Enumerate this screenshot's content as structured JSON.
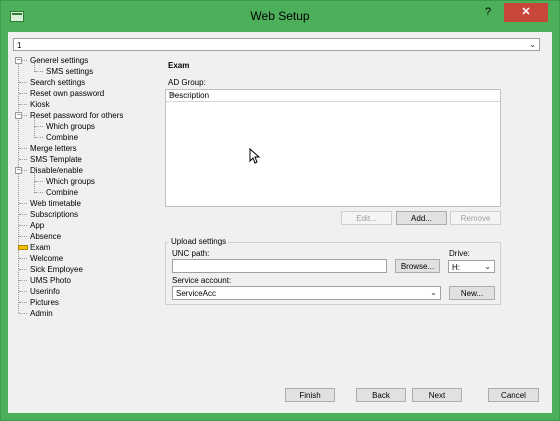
{
  "window": {
    "title": "Web Setup",
    "help_label": "?",
    "close_label": "✕",
    "accent": "#4cb05a",
    "close_color": "#c7483a"
  },
  "top_combo": {
    "value": "1"
  },
  "tree": {
    "items": [
      {
        "label": "Generel settings",
        "level": 0,
        "expander": "−"
      },
      {
        "label": "SMS settings",
        "level": 1
      },
      {
        "label": "Search settings",
        "level": 0
      },
      {
        "label": "Reset own password",
        "level": 0
      },
      {
        "label": "Kiosk",
        "level": 0
      },
      {
        "label": "Reset password for others",
        "level": 0,
        "expander": "−"
      },
      {
        "label": "Which groups",
        "level": 1
      },
      {
        "label": "Combine",
        "level": 1
      },
      {
        "label": "Merge letters",
        "level": 0
      },
      {
        "label": "SMS Template",
        "level": 0
      },
      {
        "label": "Disable/enable",
        "level": 0,
        "expander": "−"
      },
      {
        "label": "Which groups",
        "level": 1
      },
      {
        "label": "Combine",
        "level": 1
      },
      {
        "label": "Web timetable",
        "level": 0
      },
      {
        "label": "Subscriptions",
        "level": 0
      },
      {
        "label": "App",
        "level": 0
      },
      {
        "label": "Absence",
        "level": 0
      },
      {
        "label": "Exam",
        "level": 0,
        "selected": true
      },
      {
        "label": "Welcome",
        "level": 0
      },
      {
        "label": "Sick Employee",
        "level": 0
      },
      {
        "label": "UMS Photo",
        "level": 0
      },
      {
        "label": "Userinfo",
        "level": 0
      },
      {
        "label": "Pictures",
        "level": 0
      },
      {
        "label": "Admin",
        "level": 0
      }
    ]
  },
  "main": {
    "section_title": "Exam",
    "ad_group_label": "AD Group:",
    "list_header": "Description",
    "edit_label": "Edit...",
    "add_label": "Add...",
    "remove_label": "Remove"
  },
  "upload": {
    "group_title": "Upload settings",
    "unc_label": "UNC path:",
    "unc_value": "",
    "browse_label": "Browse...",
    "drive_label": "Drive:",
    "drive_value": "H:",
    "service_label": "Service account:",
    "service_value": "ServiceAcc",
    "new_label": "New..."
  },
  "footer": {
    "finish_label": "Finish",
    "back_label": "Back",
    "next_label": "Next",
    "cancel_label": "Cancel"
  }
}
